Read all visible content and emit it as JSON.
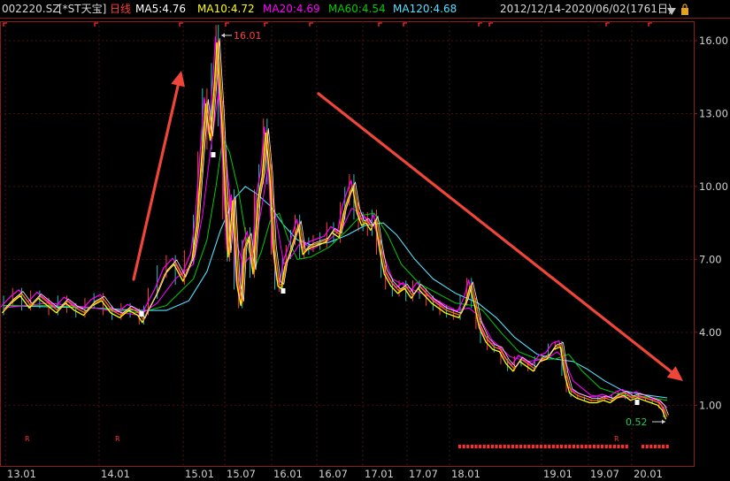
{
  "header": {
    "code": "002220.SZ",
    "name": "[*ST天宝]",
    "period": "日线",
    "ma5": "MA5:4.76",
    "ma10": "MA10:4.72",
    "ma20": "MA20:4.69",
    "ma60": "MA60:4.54",
    "ma120": "MA120:4.68",
    "range": "2012/12/14-2020/06/02(1761日)",
    "colors": {
      "code": "#d9d9d9",
      "period": "#ff3b3b",
      "ma5": "#ffffff",
      "ma10": "#ffff00",
      "ma20": "#ff00ff",
      "ma60": "#00cc00",
      "ma120": "#55e0ff"
    }
  },
  "chart_data": {
    "type": "line",
    "x_labels": [
      "13.01",
      "14.01",
      "15.01",
      "15.07",
      "16.01",
      "16.07",
      "17.01",
      "17.07",
      "18.01",
      "19.01",
      "19.07",
      "20.01"
    ],
    "y_ticks": [
      "16.00",
      "13.00",
      "10.00",
      "7.00",
      "4.00",
      "1.00"
    ],
    "ylim": [
      -1.5,
      16.8
    ],
    "annotations": {
      "high": "16.01",
      "low": "0.52",
      "markers": "R"
    },
    "price": [
      [
        0,
        4.9
      ],
      [
        2,
        5.3
      ],
      [
        4,
        5.6
      ],
      [
        6,
        5.1
      ],
      [
        8,
        5.5
      ],
      [
        10,
        5.2
      ],
      [
        12,
        4.9
      ],
      [
        14,
        5.3
      ],
      [
        16,
        5.0
      ],
      [
        18,
        4.8
      ],
      [
        20,
        5.2
      ],
      [
        22,
        5.4
      ],
      [
        24,
        4.9
      ],
      [
        26,
        4.7
      ],
      [
        28,
        5.0
      ],
      [
        30,
        4.8
      ],
      [
        31,
        4.5
      ],
      [
        32,
        4.9
      ],
      [
        34,
        5.6
      ],
      [
        36,
        6.5
      ],
      [
        38,
        6.9
      ],
      [
        40,
        6.2
      ],
      [
        42,
        7.1
      ],
      [
        43,
        8.5
      ],
      [
        44,
        11.0
      ],
      [
        45,
        13.5
      ],
      [
        46,
        12.0
      ],
      [
        47,
        14.5
      ],
      [
        47.5,
        16.01
      ],
      [
        48.5,
        13.0
      ],
      [
        49.5,
        9.0
      ],
      [
        50,
        7.2
      ],
      [
        51,
        9.5
      ],
      [
        52,
        6.0
      ],
      [
        52.8,
        5.2
      ],
      [
        53.5,
        7.5
      ],
      [
        54.5,
        8.0
      ],
      [
        55.5,
        6.5
      ],
      [
        56.5,
        9.5
      ],
      [
        57.5,
        10.5
      ],
      [
        58.3,
        12.3
      ],
      [
        59.2,
        10.5
      ],
      [
        60,
        7.5
      ],
      [
        61,
        6.0
      ],
      [
        61.7,
        5.9
      ],
      [
        62.5,
        6.8
      ],
      [
        63.5,
        7.3
      ],
      [
        64.5,
        7.9
      ],
      [
        65.5,
        8.5
      ],
      [
        66.5,
        7.3
      ],
      [
        67.5,
        7.5
      ],
      [
        68.5,
        7.6
      ],
      [
        70,
        7.7
      ],
      [
        71.5,
        7.8
      ],
      [
        73,
        8.2
      ],
      [
        74.5,
        8.0
      ],
      [
        75.5,
        9.0
      ],
      [
        76.5,
        9.6
      ],
      [
        77.5,
        10.1
      ],
      [
        78.5,
        9.0
      ],
      [
        79.5,
        8.5
      ],
      [
        80.5,
        8.6
      ],
      [
        81.5,
        8.3
      ],
      [
        82.5,
        8.7
      ],
      [
        83.5,
        7.5
      ],
      [
        84.5,
        6.5
      ],
      [
        86,
        6.0
      ],
      [
        87.5,
        5.7
      ],
      [
        89,
        5.9
      ],
      [
        90.5,
        5.5
      ],
      [
        92,
        5.9
      ],
      [
        93.5,
        5.6
      ],
      [
        95,
        5.3
      ],
      [
        96.5,
        5.1
      ],
      [
        98,
        4.9
      ],
      [
        99.5,
        4.8
      ],
      [
        101,
        4.7
      ],
      [
        102.5,
        5.3
      ],
      [
        103.5,
        6.0
      ],
      [
        104.5,
        5.2
      ],
      [
        105.5,
        4.3
      ],
      [
        107,
        3.7
      ],
      [
        108.5,
        3.4
      ],
      [
        110,
        3.3
      ],
      [
        111.5,
        2.8
      ],
      [
        113,
        2.5
      ],
      [
        114.5,
        2.9
      ],
      [
        116,
        2.7
      ],
      [
        117.5,
        2.5
      ],
      [
        119,
        2.9
      ],
      [
        120.5,
        3.0
      ],
      [
        122,
        3.4
      ],
      [
        123.5,
        3.5
      ],
      [
        124.5,
        2.3
      ],
      [
        125.5,
        1.6
      ],
      [
        127,
        1.4
      ],
      [
        128.5,
        1.3
      ],
      [
        130,
        1.2
      ],
      [
        131.5,
        1.2
      ],
      [
        133,
        1.3
      ],
      [
        134.5,
        1.2
      ],
      [
        136,
        1.4
      ],
      [
        137.5,
        1.5
      ],
      [
        139,
        1.3
      ],
      [
        140.5,
        1.4
      ],
      [
        142,
        1.3
      ],
      [
        143.5,
        1.2
      ],
      [
        145,
        1.1
      ],
      [
        146,
        0.9
      ],
      [
        146.8,
        0.52
      ]
    ],
    "ma20": [
      [
        0,
        5.0
      ],
      [
        10,
        5.2
      ],
      [
        20,
        5.0
      ],
      [
        30,
        4.7
      ],
      [
        34,
        5.2
      ],
      [
        38,
        6.2
      ],
      [
        42,
        6.8
      ],
      [
        44,
        8.8
      ],
      [
        46,
        11.8
      ],
      [
        47.5,
        13.8
      ],
      [
        49,
        11.5
      ],
      [
        51,
        8.0
      ],
      [
        53,
        6.8
      ],
      [
        55,
        7.2
      ],
      [
        57,
        9.0
      ],
      [
        58.5,
        10.8
      ],
      [
        60,
        9.0
      ],
      [
        62,
        6.8
      ],
      [
        64,
        7.2
      ],
      [
        66,
        7.8
      ],
      [
        68,
        7.4
      ],
      [
        72,
        7.8
      ],
      [
        75,
        8.3
      ],
      [
        77,
        9.1
      ],
      [
        79,
        8.9
      ],
      [
        82,
        8.4
      ],
      [
        84,
        7.2
      ],
      [
        86,
        6.2
      ],
      [
        90,
        5.8
      ],
      [
        95,
        5.4
      ],
      [
        100,
        4.9
      ],
      [
        103,
        5.0
      ],
      [
        105,
        4.7
      ],
      [
        108,
        3.7
      ],
      [
        112,
        3.0
      ],
      [
        116,
        2.8
      ],
      [
        120,
        2.9
      ],
      [
        122.5,
        3.2
      ],
      [
        124,
        2.9
      ],
      [
        126,
        2.0
      ],
      [
        130,
        1.4
      ],
      [
        135,
        1.3
      ],
      [
        140,
        1.35
      ],
      [
        145,
        1.2
      ],
      [
        146.8,
        0.9
      ]
    ],
    "ma60": [
      [
        0,
        5.1
      ],
      [
        10,
        5.1
      ],
      [
        20,
        5.0
      ],
      [
        30,
        4.8
      ],
      [
        36,
        5.1
      ],
      [
        42,
        6.2
      ],
      [
        45,
        7.8
      ],
      [
        47,
        10.0
      ],
      [
        48.5,
        12.0
      ],
      [
        50,
        11.4
      ],
      [
        52,
        9.8
      ],
      [
        54,
        7.5
      ],
      [
        55.5,
        6.6
      ],
      [
        57,
        7.3
      ],
      [
        59,
        8.6
      ],
      [
        61,
        8.9
      ],
      [
        63,
        7.8
      ],
      [
        65,
        7.0
      ],
      [
        68,
        7.1
      ],
      [
        72,
        7.5
      ],
      [
        76,
        8.2
      ],
      [
        79,
        8.8
      ],
      [
        82,
        8.9
      ],
      [
        85,
        8.0
      ],
      [
        88,
        6.8
      ],
      [
        92,
        6.0
      ],
      [
        96,
        5.6
      ],
      [
        100,
        5.2
      ],
      [
        104,
        5.1
      ],
      [
        106,
        4.9
      ],
      [
        110,
        4.0
      ],
      [
        114,
        3.2
      ],
      [
        118,
        2.9
      ],
      [
        122,
        2.9
      ],
      [
        125,
        3.1
      ],
      [
        128,
        2.4
      ],
      [
        132,
        1.7
      ],
      [
        137,
        1.4
      ],
      [
        142,
        1.35
      ],
      [
        146.8,
        1.2
      ]
    ],
    "ma120": [
      [
        0,
        5.1
      ],
      [
        10,
        5.05
      ],
      [
        20,
        5.0
      ],
      [
        30,
        4.9
      ],
      [
        36,
        4.9
      ],
      [
        41,
        5.3
      ],
      [
        45,
        6.5
      ],
      [
        48,
        8.2
      ],
      [
        51,
        9.5
      ],
      [
        53.5,
        10.0
      ],
      [
        56,
        9.7
      ],
      [
        59,
        9.2
      ],
      [
        62,
        8.4
      ],
      [
        65,
        7.8
      ],
      [
        68,
        7.6
      ],
      [
        72,
        7.7
      ],
      [
        76,
        8.0
      ],
      [
        80,
        8.4
      ],
      [
        84,
        8.5
      ],
      [
        87,
        8.0
      ],
      [
        91,
        7.0
      ],
      [
        95,
        6.2
      ],
      [
        100,
        5.6
      ],
      [
        105,
        5.2
      ],
      [
        109,
        4.6
      ],
      [
        113,
        3.8
      ],
      [
        118,
        3.1
      ],
      [
        122,
        2.9
      ],
      [
        126,
        2.8
      ],
      [
        129,
        2.5
      ],
      [
        133,
        2.0
      ],
      [
        137,
        1.6
      ],
      [
        141,
        1.45
      ],
      [
        146.8,
        1.3
      ]
    ]
  }
}
